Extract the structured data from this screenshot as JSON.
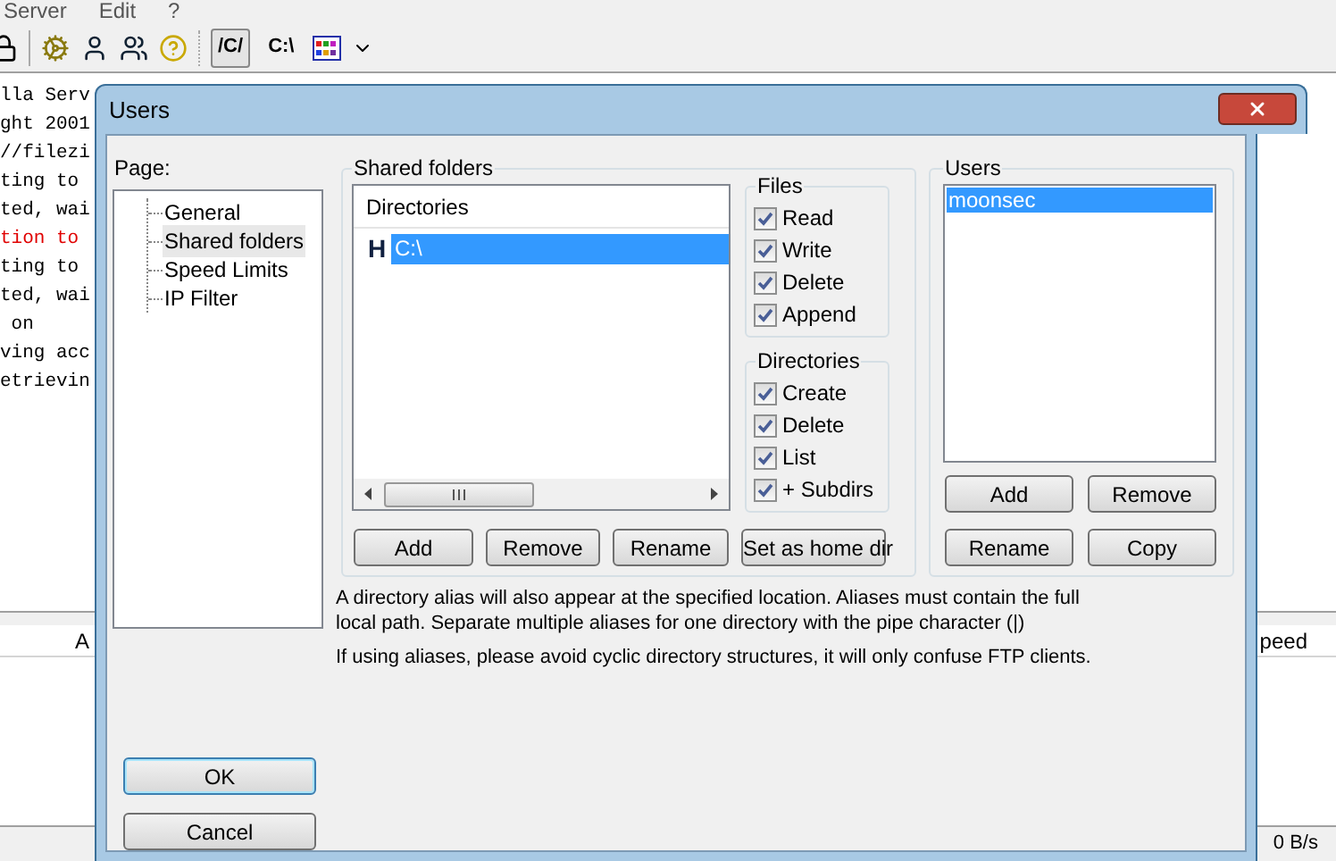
{
  "app": {
    "menu": [
      "Server",
      "Edit",
      "?"
    ],
    "toolbar_text_buttons": [
      {
        "label": "/C/",
        "selected": true
      },
      {
        "label": "C:\\",
        "selected": false
      }
    ],
    "log_lines": [
      {
        "text": "lla Serv",
        "kind": "normal"
      },
      {
        "text": "ght 2001",
        "kind": "normal"
      },
      {
        "text": "//filezi",
        "kind": "normal"
      },
      {
        "text": "ting to",
        "kind": "normal"
      },
      {
        "text": "ted, wai",
        "kind": "normal"
      },
      {
        "text": "tion to",
        "kind": "error"
      },
      {
        "text": "ting to",
        "kind": "normal"
      },
      {
        "text": "ted, wai",
        "kind": "normal"
      },
      {
        "text": " on",
        "kind": "normal"
      },
      {
        "text": "ving acc",
        "kind": "normal"
      },
      {
        "text": "etrievin",
        "kind": "normal"
      }
    ],
    "columns": [
      "A",
      "peed"
    ],
    "status": "0 B/s"
  },
  "dialog": {
    "title": "Users",
    "page_label": "Page:",
    "pages": [
      {
        "label": "General",
        "selected": false
      },
      {
        "label": "Shared folders",
        "selected": true
      },
      {
        "label": "Speed Limits",
        "selected": false
      },
      {
        "label": "IP Filter",
        "selected": false
      }
    ],
    "shared_folders": {
      "title": "Shared folders",
      "column": "Directories",
      "rows": [
        {
          "home_mark": "H",
          "path": "C:\\",
          "selected": true
        }
      ],
      "files": {
        "title": "Files",
        "perms": [
          {
            "label": "Read",
            "checked": true
          },
          {
            "label": "Write",
            "checked": true
          },
          {
            "label": "Delete",
            "checked": true
          },
          {
            "label": "Append",
            "checked": true
          }
        ]
      },
      "directories": {
        "title": "Directories",
        "perms": [
          {
            "label": "Create",
            "checked": true
          },
          {
            "label": "Delete",
            "checked": true
          },
          {
            "label": "List",
            "checked": true
          },
          {
            "label": "+ Subdirs",
            "checked": true
          }
        ]
      },
      "buttons": [
        "Add",
        "Remove",
        "Rename",
        "Set as home dir"
      ]
    },
    "users": {
      "title": "Users",
      "items": [
        {
          "name": "moonsec",
          "selected": true
        }
      ],
      "buttons": [
        "Add",
        "Remove",
        "Rename",
        "Copy"
      ]
    },
    "notes": [
      "A directory alias will also appear at the specified location. Aliases must contain the full local path. Separate multiple aliases for one directory with the pipe character (|)",
      "If using aliases, please avoid cyclic directory structures, it will only confuse FTP clients."
    ],
    "ok": "OK",
    "cancel": "Cancel"
  }
}
